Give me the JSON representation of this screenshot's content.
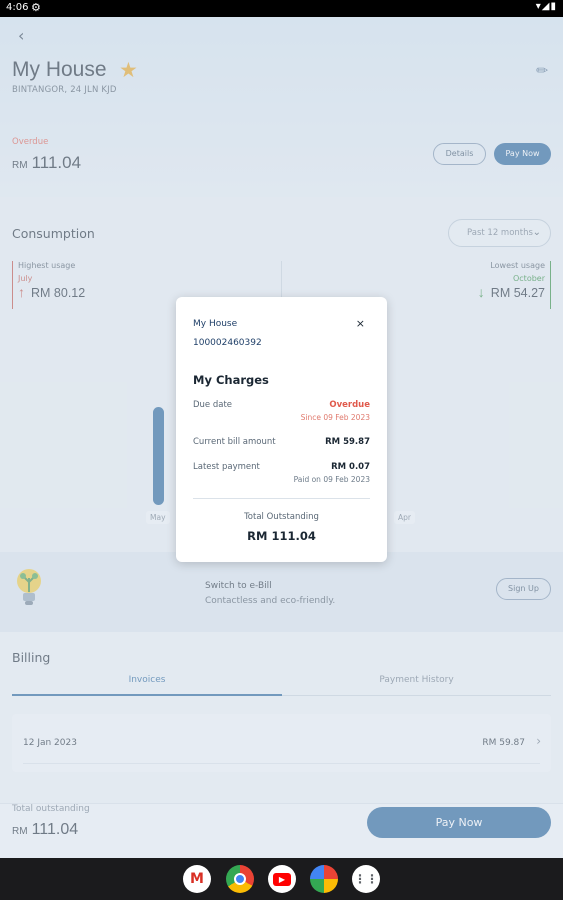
{
  "status_bar": {
    "time": "4:06"
  },
  "header": {
    "title": "My House",
    "subtitle": "BINTANGOR, 24 JLN KJD"
  },
  "summary": {
    "status": "Overdue",
    "currency": "RM",
    "amount": "111.04",
    "details_label": "Details",
    "pay_label": "Pay Now"
  },
  "consumption": {
    "title": "Consumption",
    "period": "Past 12 months",
    "highest": {
      "label": "Highest usage",
      "month": "July",
      "value": "RM 80.12"
    },
    "lowest": {
      "label": "Lowest usage",
      "month": "October",
      "value": "RM 54.27"
    },
    "months": [
      "May",
      "Apr"
    ]
  },
  "ebill": {
    "title": "Switch to e-Bill",
    "subtitle": "Contactless and eco-friendly.",
    "button": "Sign Up"
  },
  "billing": {
    "title": "Billing",
    "tabs": [
      "Invoices",
      "Payment History"
    ],
    "rows": [
      {
        "date": "12 Jan 2023",
        "amount": "RM 59.87"
      }
    ]
  },
  "bottom": {
    "label": "Total outstanding",
    "currency": "RM",
    "amount": "111.04",
    "pay_label": "Pay Now"
  },
  "dialog": {
    "name": "My House",
    "account": "100002460392",
    "section": "My Charges",
    "due_label": "Due date",
    "due_value": "Overdue",
    "due_sub": "Since 09 Feb 2023",
    "bill_label": "Current bill amount",
    "bill_value": "RM 59.87",
    "latest_label": "Latest payment",
    "latest_value": "RM 0.07",
    "latest_sub": "Paid on 09 Feb 2023",
    "total_label": "Total Outstanding",
    "total_value": "RM 111.04",
    "close": "×"
  },
  "colors": {
    "brand": "#1f5f98",
    "overdue": "#e05a4c",
    "positive": "#2a8a3a"
  }
}
